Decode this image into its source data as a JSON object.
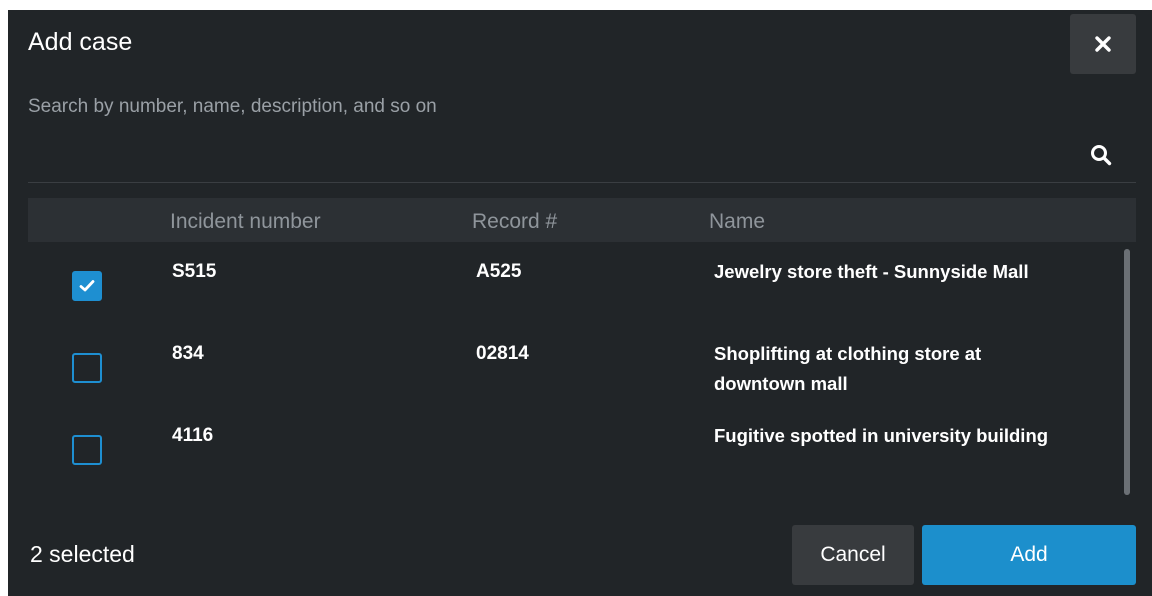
{
  "dialog": {
    "title": "Add case",
    "close_icon": "close-icon"
  },
  "search": {
    "placeholder": "Search by number, name, description, and so on",
    "value": "",
    "icon": "search-icon"
  },
  "table": {
    "columns": [
      "Incident number",
      "Record #",
      "Name"
    ],
    "rows": [
      {
        "checked": true,
        "incident_number": "S515",
        "record": "A525",
        "name": "Jewelry store theft - Sunnyside Mall"
      },
      {
        "checked": false,
        "incident_number": "834",
        "record": "02814",
        "name": "Shoplifting at clothing store at downtown mall"
      },
      {
        "checked": false,
        "incident_number": "4116",
        "record": "",
        "name": "Fugitive spotted in university building"
      }
    ]
  },
  "footer": {
    "selected_text": "2 selected",
    "cancel_label": "Cancel",
    "add_label": "Add"
  },
  "colors": {
    "background": "#212528",
    "header_bg": "#2c3034",
    "accent": "#1c8fcc",
    "secondary_button": "#383b3e",
    "muted_text": "#8f959b"
  }
}
